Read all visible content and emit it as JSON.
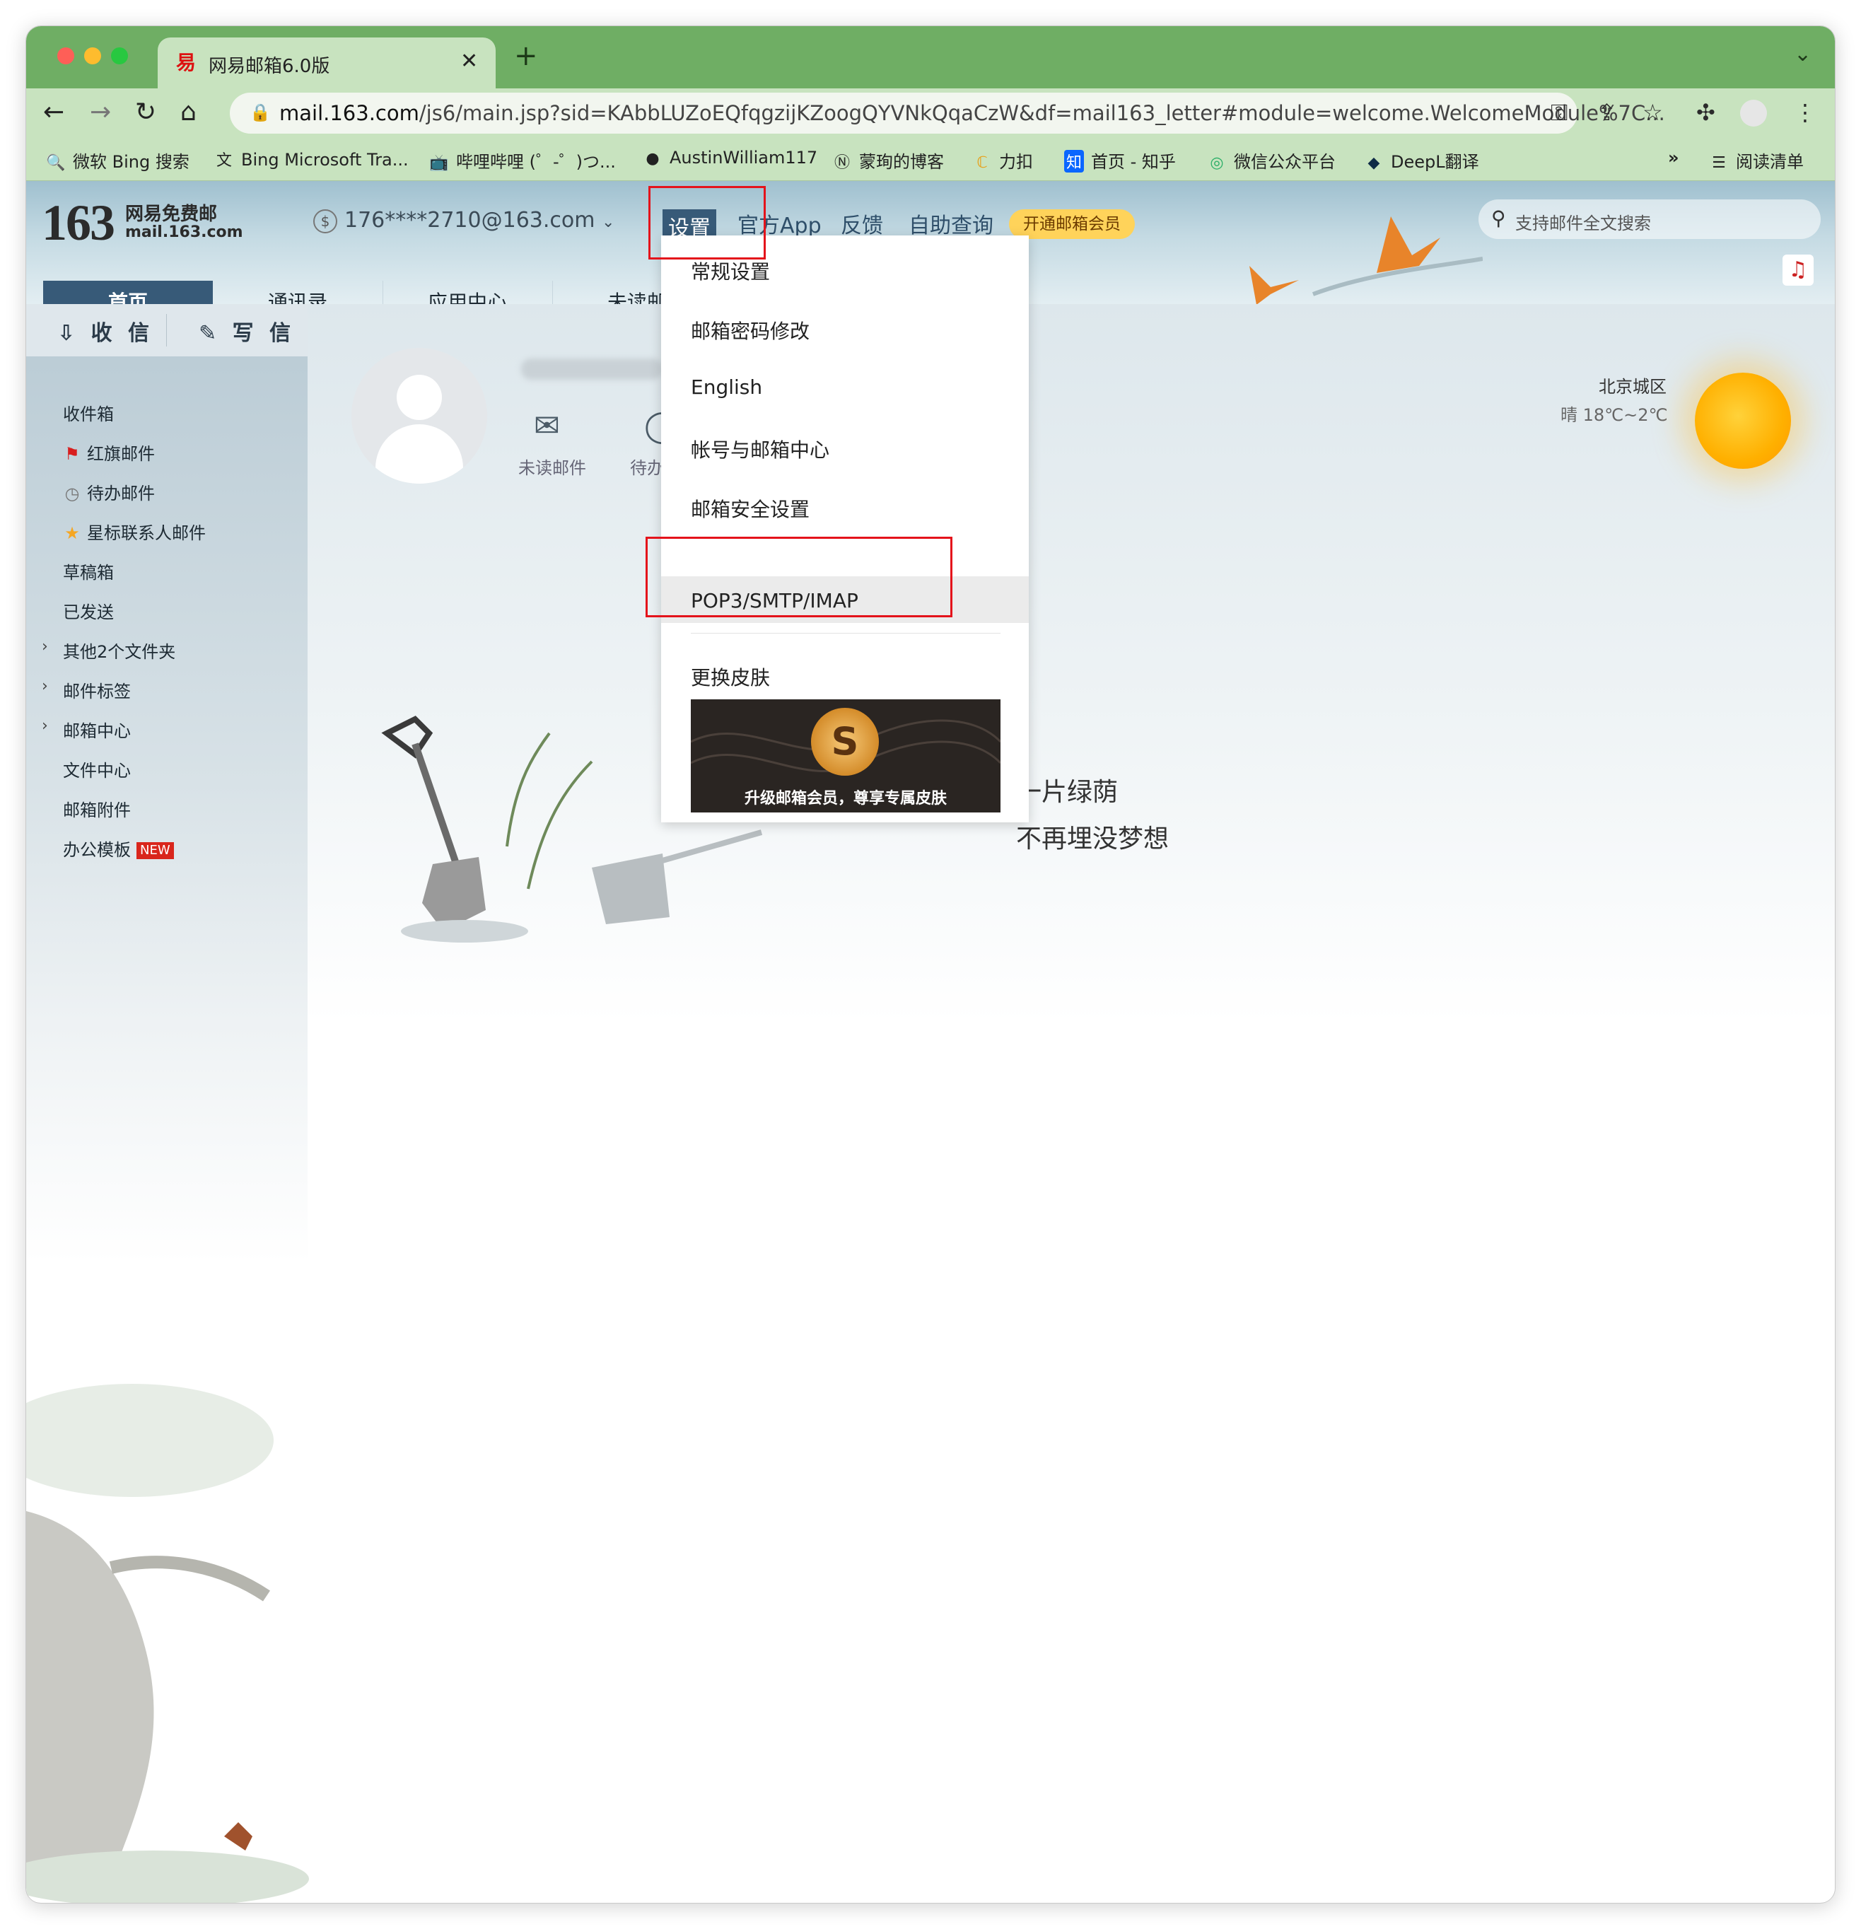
{
  "browser": {
    "tab_title": "网易邮箱6.0版",
    "tab_favicon": "易",
    "url_host": "mail.163.com",
    "url_path": "/js6/main.jsp?sid=KAbbLUZoEQfqgzijKZoogQYVNkQqaCzW&df=mail163_letter#module=welcome.WelcomeModule%7C...",
    "bookmarks": [
      {
        "label": "微软 Bing 搜索",
        "icon": "search-icon"
      },
      {
        "label": "Bing Microsoft Tra...",
        "icon": "translate-icon"
      },
      {
        "label": "哔哩哔哩 (゜-゜)つ...",
        "icon": "bilibili-icon"
      },
      {
        "label": "AustinWilliam117",
        "icon": "github-icon"
      },
      {
        "label": "蒙珣的博客",
        "icon": "blog-icon"
      },
      {
        "label": "力扣",
        "icon": "leetcode-icon"
      },
      {
        "label": "首页 - 知乎",
        "icon": "zhihu-icon"
      },
      {
        "label": "微信公众平台",
        "icon": "wechat-icon"
      },
      {
        "label": "DeepL翻译",
        "icon": "deepl-icon"
      }
    ],
    "more_bookmarks": "»",
    "reading_list": "阅读清单"
  },
  "header": {
    "logo_number": "163",
    "logo_line1": "网易免费邮",
    "logo_line2": "mail.163.com",
    "account": "176****2710@163.com",
    "links": {
      "settings": "设置",
      "official_app": "官方App",
      "feedback": "反馈",
      "self_service": "自助查询"
    },
    "vip_badge": "开通邮箱会员",
    "search_placeholder": "支持邮件全文搜索"
  },
  "nav_tabs": [
    "首页",
    "通讯录",
    "应用中心",
    "未读邮"
  ],
  "sidebar": {
    "receive": "收 信",
    "write": "写 信",
    "items": [
      {
        "label": "收件箱"
      },
      {
        "label": "红旗邮件"
      },
      {
        "label": "待办邮件"
      },
      {
        "label": "星标联系人邮件"
      },
      {
        "label": "草稿箱"
      },
      {
        "label": "已发送"
      },
      {
        "label": "其他2个文件夹"
      },
      {
        "label": "邮件标签"
      },
      {
        "label": "邮箱中心"
      },
      {
        "label": "文件中心"
      },
      {
        "label": "邮箱附件"
      },
      {
        "label": "办公模板"
      }
    ],
    "new_badge": "NEW"
  },
  "welcome": {
    "quick_unread": "未读邮件",
    "quick_todo": "待办",
    "weather_city": "北京城区",
    "weather_temp": "晴 18℃~2℃",
    "slogan_line1": "一片绿荫",
    "slogan_line2": "不再埋没梦想"
  },
  "settings_menu": {
    "items": [
      "常规设置",
      "邮箱密码修改",
      "English",
      "帐号与邮箱中心",
      "邮箱安全设置",
      "POP3/SMTP/IMAP",
      "更换皮肤"
    ],
    "banner_text": "升级邮箱会员，尊享专属皮肤"
  }
}
